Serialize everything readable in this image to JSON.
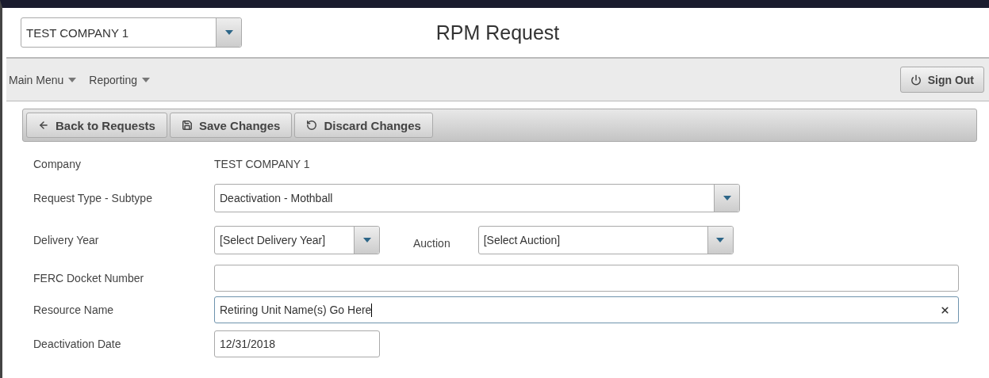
{
  "header": {
    "company_select": {
      "value": "TEST COMPANY 1"
    },
    "title": "RPM Request"
  },
  "nav": {
    "menus": [
      {
        "label": "Main Menu"
      },
      {
        "label": "Reporting"
      }
    ],
    "sign_out": "Sign Out"
  },
  "toolbar": [
    {
      "kind": "back",
      "label": "Back to Requests"
    },
    {
      "kind": "save",
      "label": "Save Changes"
    },
    {
      "kind": "discard",
      "label": "Discard Changes"
    }
  ],
  "form": [
    {
      "kind": "text",
      "label": "Company",
      "value": "TEST COMPANY 1"
    },
    {
      "kind": "select",
      "label": "Request Type - Subtype",
      "value": "Deactivation - Mothball"
    },
    {
      "kind": "select-pair",
      "label": "Delivery Year",
      "value": "[Select Delivery Year]",
      "second_label": "Auction",
      "second_value": "[Select Auction]"
    },
    {
      "kind": "input",
      "label": "FERC Docket Number",
      "focused": false
    },
    {
      "kind": "input",
      "label": "Resource Name",
      "value": "Retiring Unit Name(s) Go Here",
      "focused": true,
      "clearable": true
    },
    {
      "kind": "date",
      "label": "Deactivation Date",
      "value": "12/31/2018",
      "focused": false
    }
  ]
}
